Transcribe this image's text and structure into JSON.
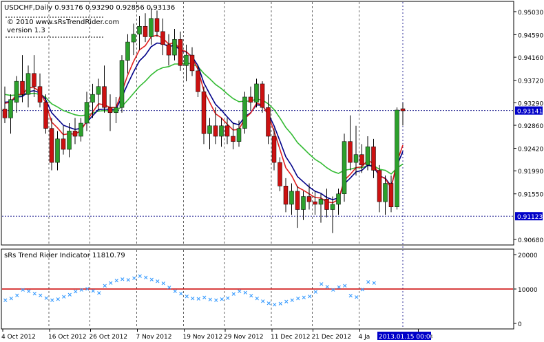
{
  "header": {
    "symbol_line": "USDCHF,Daily  0.93176 0.93290 0.92856 0.93136",
    "copyright": "© 2010 www.sRsTrendRider.com",
    "version": "version 1.3"
  },
  "indicator": {
    "title": "sRs Trend Rider Indicator 11810.79",
    "ticks": [
      "20000",
      "10000",
      "0"
    ],
    "tick_values": [
      20000,
      10000,
      0
    ],
    "level": 10000,
    "range": [
      0,
      20000
    ]
  },
  "price_axis": {
    "ticks": [
      "0.95030",
      "0.94590",
      "0.94160",
      "0.93720",
      "0.93290",
      "0.92860",
      "0.92420",
      "0.91990",
      "0.91550",
      "0.90680"
    ],
    "tick_values": [
      0.9503,
      0.9459,
      0.9416,
      0.9372,
      0.9329,
      0.9286,
      0.9242,
      0.9199,
      0.9155,
      0.9068
    ],
    "price_tag": "0.93141",
    "price_tag_value": 0.93141,
    "low_tag": "0.91123",
    "low_tag_value": 0.91123
  },
  "time_axis": {
    "labels": [
      "4 Oct 2012",
      "16 Oct 2012",
      "26 Oct 2012",
      "7 Nov 2012",
      "19 Nov 2012",
      "29 Nov 2012",
      "11 Dec 2012",
      "21 Dec 2012",
      "4 Ja",
      "2013"
    ],
    "label_bars": [
      0,
      8,
      15,
      23,
      31,
      38,
      46,
      53,
      61,
      71
    ],
    "cursor_label": "2013.01.15 00:00",
    "cursor_bar": 68
  },
  "colors": {
    "background": "#ffffff",
    "grid": "#000080",
    "bull": "#2ca02c",
    "bear": "#cc1111",
    "ema_fast": "#e02020",
    "ema_mid": "#000088",
    "ema_slow": "#33bb33",
    "indicator_level": "#cc0000",
    "indicator_points": "#3399ff",
    "highlight": "#0000c8",
    "highlight_text": "#ffffff"
  },
  "chart_data": {
    "type": "candlestick",
    "symbol": "USDCHF",
    "timeframe": "Daily",
    "ylim": [
      0.906,
      0.952
    ],
    "grid": true,
    "candles": [
      {
        "o": 0.9317,
        "h": 0.936,
        "l": 0.929,
        "c": 0.93
      },
      {
        "o": 0.93,
        "h": 0.9345,
        "l": 0.927,
        "c": 0.9335
      },
      {
        "o": 0.933,
        "h": 0.938,
        "l": 0.931,
        "c": 0.937
      },
      {
        "o": 0.937,
        "h": 0.942,
        "l": 0.933,
        "c": 0.9345
      },
      {
        "o": 0.9345,
        "h": 0.94,
        "l": 0.932,
        "c": 0.9385
      },
      {
        "o": 0.9385,
        "h": 0.942,
        "l": 0.934,
        "c": 0.936
      },
      {
        "o": 0.936,
        "h": 0.9385,
        "l": 0.932,
        "c": 0.933
      },
      {
        "o": 0.933,
        "h": 0.9345,
        "l": 0.927,
        "c": 0.928
      },
      {
        "o": 0.928,
        "h": 0.93,
        "l": 0.92,
        "c": 0.9215
      },
      {
        "o": 0.9215,
        "h": 0.9275,
        "l": 0.92,
        "c": 0.926
      },
      {
        "o": 0.926,
        "h": 0.9285,
        "l": 0.923,
        "c": 0.924
      },
      {
        "o": 0.924,
        "h": 0.929,
        "l": 0.9225,
        "c": 0.9275
      },
      {
        "o": 0.9275,
        "h": 0.93,
        "l": 0.925,
        "c": 0.9265
      },
      {
        "o": 0.9265,
        "h": 0.93,
        "l": 0.9255,
        "c": 0.929
      },
      {
        "o": 0.929,
        "h": 0.935,
        "l": 0.9275,
        "c": 0.933
      },
      {
        "o": 0.933,
        "h": 0.9365,
        "l": 0.93,
        "c": 0.9345
      },
      {
        "o": 0.9345,
        "h": 0.9375,
        "l": 0.9315,
        "c": 0.936
      },
      {
        "o": 0.936,
        "h": 0.94,
        "l": 0.931,
        "c": 0.932
      },
      {
        "o": 0.932,
        "h": 0.9345,
        "l": 0.9275,
        "c": 0.931
      },
      {
        "o": 0.931,
        "h": 0.934,
        "l": 0.929,
        "c": 0.932
      },
      {
        "o": 0.932,
        "h": 0.942,
        "l": 0.931,
        "c": 0.941
      },
      {
        "o": 0.941,
        "h": 0.946,
        "l": 0.9385,
        "c": 0.9445
      },
      {
        "o": 0.9445,
        "h": 0.948,
        "l": 0.942,
        "c": 0.946
      },
      {
        "o": 0.946,
        "h": 0.9495,
        "l": 0.943,
        "c": 0.9475
      },
      {
        "o": 0.9475,
        "h": 0.95,
        "l": 0.9445,
        "c": 0.9455
      },
      {
        "o": 0.9455,
        "h": 0.951,
        "l": 0.944,
        "c": 0.949
      },
      {
        "o": 0.949,
        "h": 0.9505,
        "l": 0.9455,
        "c": 0.9465
      },
      {
        "o": 0.9465,
        "h": 0.949,
        "l": 0.942,
        "c": 0.944
      },
      {
        "o": 0.944,
        "h": 0.946,
        "l": 0.94,
        "c": 0.942
      },
      {
        "o": 0.942,
        "h": 0.947,
        "l": 0.941,
        "c": 0.945
      },
      {
        "o": 0.945,
        "h": 0.9465,
        "l": 0.939,
        "c": 0.94
      },
      {
        "o": 0.94,
        "h": 0.944,
        "l": 0.937,
        "c": 0.942
      },
      {
        "o": 0.942,
        "h": 0.9435,
        "l": 0.938,
        "c": 0.939
      },
      {
        "o": 0.939,
        "h": 0.94,
        "l": 0.934,
        "c": 0.935
      },
      {
        "o": 0.935,
        "h": 0.936,
        "l": 0.925,
        "c": 0.927
      },
      {
        "o": 0.927,
        "h": 0.93,
        "l": 0.924,
        "c": 0.9285
      },
      {
        "o": 0.9285,
        "h": 0.932,
        "l": 0.925,
        "c": 0.9265
      },
      {
        "o": 0.9265,
        "h": 0.93,
        "l": 0.9245,
        "c": 0.9285
      },
      {
        "o": 0.9285,
        "h": 0.93,
        "l": 0.925,
        "c": 0.9265
      },
      {
        "o": 0.9265,
        "h": 0.929,
        "l": 0.924,
        "c": 0.9255
      },
      {
        "o": 0.9255,
        "h": 0.9295,
        "l": 0.9245,
        "c": 0.928
      },
      {
        "o": 0.928,
        "h": 0.935,
        "l": 0.927,
        "c": 0.934
      },
      {
        "o": 0.934,
        "h": 0.936,
        "l": 0.9315,
        "c": 0.933
      },
      {
        "o": 0.933,
        "h": 0.9375,
        "l": 0.932,
        "c": 0.9365
      },
      {
        "o": 0.9365,
        "h": 0.937,
        "l": 0.931,
        "c": 0.932
      },
      {
        "o": 0.932,
        "h": 0.9345,
        "l": 0.925,
        "c": 0.9265
      },
      {
        "o": 0.9265,
        "h": 0.928,
        "l": 0.92,
        "c": 0.9215
      },
      {
        "o": 0.9215,
        "h": 0.9225,
        "l": 0.916,
        "c": 0.917
      },
      {
        "o": 0.917,
        "h": 0.9185,
        "l": 0.912,
        "c": 0.9135
      },
      {
        "o": 0.9135,
        "h": 0.9175,
        "l": 0.9115,
        "c": 0.916
      },
      {
        "o": 0.916,
        "h": 0.917,
        "l": 0.909,
        "c": 0.9125
      },
      {
        "o": 0.9125,
        "h": 0.916,
        "l": 0.9105,
        "c": 0.915
      },
      {
        "o": 0.915,
        "h": 0.9175,
        "l": 0.9125,
        "c": 0.914
      },
      {
        "o": 0.914,
        "h": 0.916,
        "l": 0.9115,
        "c": 0.9135
      },
      {
        "o": 0.9135,
        "h": 0.9155,
        "l": 0.91,
        "c": 0.9145
      },
      {
        "o": 0.9145,
        "h": 0.9165,
        "l": 0.911,
        "c": 0.9125
      },
      {
        "o": 0.9125,
        "h": 0.915,
        "l": 0.908,
        "c": 0.9135
      },
      {
        "o": 0.9135,
        "h": 0.9165,
        "l": 0.9115,
        "c": 0.9155
      },
      {
        "o": 0.9155,
        "h": 0.927,
        "l": 0.914,
        "c": 0.9255
      },
      {
        "o": 0.9255,
        "h": 0.9305,
        "l": 0.92,
        "c": 0.9215
      },
      {
        "o": 0.9215,
        "h": 0.9285,
        "l": 0.919,
        "c": 0.923
      },
      {
        "o": 0.923,
        "h": 0.925,
        "l": 0.9195,
        "c": 0.921
      },
      {
        "o": 0.921,
        "h": 0.9265,
        "l": 0.92,
        "c": 0.9245
      },
      {
        "o": 0.9245,
        "h": 0.926,
        "l": 0.9185,
        "c": 0.92
      },
      {
        "o": 0.92,
        "h": 0.921,
        "l": 0.912,
        "c": 0.914
      },
      {
        "o": 0.914,
        "h": 0.919,
        "l": 0.9115,
        "c": 0.9175
      },
      {
        "o": 0.9175,
        "h": 0.919,
        "l": 0.912,
        "c": 0.913
      },
      {
        "o": 0.913,
        "h": 0.932,
        "l": 0.9125,
        "c": 0.9315
      },
      {
        "o": 0.93176,
        "h": 0.9329,
        "l": 0.92856,
        "c": 0.93136
      }
    ],
    "ema_fast": [
      0.9328,
      0.933,
      0.9345,
      0.9345,
      0.9358,
      0.9358,
      0.935,
      0.9328,
      0.9292,
      0.9281,
      0.9268,
      0.927,
      0.9269,
      0.9276,
      0.9294,
      0.9311,
      0.9327,
      0.9325,
      0.932,
      0.932,
      0.935,
      0.9382,
      0.9408,
      0.943,
      0.9438,
      0.9455,
      0.9458,
      0.9452,
      0.9441,
      0.9444,
      0.943,
      0.9427,
      0.9415,
      0.9393,
      0.9352,
      0.933,
      0.9308,
      0.93,
      0.9288,
      0.9277,
      0.9278,
      0.9299,
      0.9309,
      0.9328,
      0.9325,
      0.9305,
      0.9275,
      0.924,
      0.9205,
      0.919,
      0.9168,
      0.9162,
      0.9155,
      0.9148,
      0.9147,
      0.914,
      0.9138,
      0.9144,
      0.9181,
      0.9192,
      0.9205,
      0.9207,
      0.9219,
      0.9213,
      0.9189,
      0.9184,
      0.9166,
      0.9216,
      0.9248
    ],
    "ema_mid": [
      0.933,
      0.9331,
      0.934,
      0.9341,
      0.935,
      0.9352,
      0.9348,
      0.9335,
      0.931,
      0.9298,
      0.9286,
      0.9282,
      0.9278,
      0.928,
      0.9292,
      0.9304,
      0.9316,
      0.9317,
      0.9316,
      0.9317,
      0.934,
      0.9365,
      0.9388,
      0.9409,
      0.942,
      0.9436,
      0.9443,
      0.9442,
      0.9436,
      0.9439,
      0.9429,
      0.9426,
      0.9417,
      0.94,
      0.9367,
      0.9346,
      0.9326,
      0.9315,
      0.9302,
      0.929,
      0.9287,
      0.9302,
      0.931,
      0.9325,
      0.9324,
      0.9308,
      0.9285,
      0.9256,
      0.9226,
      0.9209,
      0.9188,
      0.9178,
      0.9168,
      0.916,
      0.9156,
      0.9148,
      0.9144,
      0.9147,
      0.9174,
      0.9185,
      0.9197,
      0.92,
      0.921,
      0.9207,
      0.9189,
      0.9185,
      0.917,
      0.9209,
      0.9236
    ],
    "ema_slow": [
      0.9345,
      0.9343,
      0.9344,
      0.9344,
      0.9346,
      0.9347,
      0.9345,
      0.9339,
      0.9327,
      0.9321,
      0.9314,
      0.931,
      0.9306,
      0.9304,
      0.9306,
      0.9309,
      0.9313,
      0.9314,
      0.9313,
      0.9313,
      0.9322,
      0.9334,
      0.9347,
      0.936,
      0.937,
      0.9382,
      0.9391,
      0.9396,
      0.9398,
      0.9403,
      0.9403,
      0.9405,
      0.9403,
      0.9398,
      0.9385,
      0.9375,
      0.9364,
      0.9356,
      0.9346,
      0.9337,
      0.9331,
      0.9332,
      0.9332,
      0.9336,
      0.9334,
      0.9327,
      0.9316,
      0.93,
      0.9282,
      0.9269,
      0.9253,
      0.9242,
      0.9231,
      0.9221,
      0.9214,
      0.9205,
      0.9198,
      0.9194,
      0.92,
      0.9202,
      0.9205,
      0.9205,
      0.9209,
      0.9209,
      0.9202,
      0.92,
      0.9193,
      0.9204,
      0.9212
    ],
    "indicator_values": [
      6800,
      7300,
      8200,
      9800,
      9400,
      8700,
      8200,
      7400,
      6800,
      7100,
      7800,
      8400,
      9300,
      9800,
      10100,
      9500,
      8900,
      11000,
      11800,
      12500,
      12900,
      12700,
      13200,
      13800,
      13400,
      12800,
      12300,
      11700,
      10500,
      9400,
      8700,
      7900,
      7300,
      7200,
      7600,
      7000,
      6800,
      7100,
      7400,
      8600,
      9400,
      9000,
      8100,
      7300,
      6500,
      5900,
      5500,
      5800,
      6400,
      6800,
      7300,
      7600,
      7900,
      9200,
      11500,
      10700,
      9800,
      10600,
      11000,
      8100,
      7700,
      9900,
      12100,
      11810
    ],
    "indicator_start_bar": 0
  }
}
